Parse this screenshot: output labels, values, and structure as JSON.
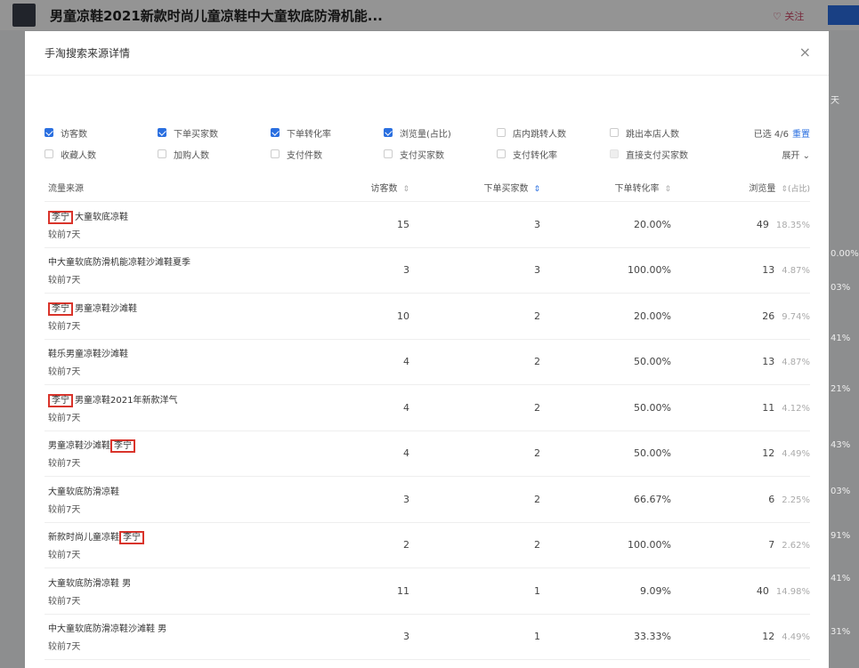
{
  "page": {
    "product_title": "男童凉鞋2021新款时尚儿童凉鞋中大童软底防滑机能...",
    "fav_label": "♡ 关注"
  },
  "modal": {
    "title": "手淘搜索来源详情",
    "close_label": "×",
    "selected_text": "已选 4/6",
    "reset_label": "重置",
    "expand_label": "展开 ⌄"
  },
  "filters": {
    "row1": [
      {
        "label": "访客数",
        "state": "checked"
      },
      {
        "label": "下单买家数",
        "state": "checked"
      },
      {
        "label": "下单转化率",
        "state": "checked"
      },
      {
        "label": "浏览量(占比)",
        "state": "checked"
      },
      {
        "label": "店内跳转人数",
        "state": "unchecked"
      },
      {
        "label": "跳出本店人数",
        "state": "unchecked"
      }
    ],
    "row2": [
      {
        "label": "收藏人数",
        "state": "unchecked"
      },
      {
        "label": "加购人数",
        "state": "unchecked"
      },
      {
        "label": "支付件数",
        "state": "unchecked"
      },
      {
        "label": "支付买家数",
        "state": "unchecked"
      },
      {
        "label": "支付转化率",
        "state": "unchecked"
      },
      {
        "label": "直接支付买家数",
        "state": "disabled"
      }
    ]
  },
  "table": {
    "headers": {
      "source": "流量来源",
      "visitors": "访客数",
      "buyers": "下单买家数",
      "conversion": "下单转化率",
      "pageviews": "浏览量",
      "share": "(占比)"
    },
    "rows": [
      {
        "keyword_hl": "李宁",
        "name": "大童软底凉鞋",
        "period": "较前7天",
        "visitors": "15",
        "buyers": "3",
        "conversion": "20.00%",
        "pageviews": "49",
        "share": "18.35%"
      },
      {
        "keyword_hl": "",
        "name": "中大童软底防滑机能凉鞋沙滩鞋夏季",
        "period": "较前7天",
        "visitors": "3",
        "buyers": "3",
        "conversion": "100.00%",
        "pageviews": "13",
        "share": "4.87%"
      },
      {
        "keyword_hl": "李宁",
        "name": "男童凉鞋沙滩鞋",
        "period": "较前7天",
        "visitors": "10",
        "buyers": "2",
        "conversion": "20.00%",
        "pageviews": "26",
        "share": "9.74%"
      },
      {
        "keyword_hl": "",
        "name": "鞋乐男童凉鞋沙滩鞋",
        "period": "较前7天",
        "visitors": "4",
        "buyers": "2",
        "conversion": "50.00%",
        "pageviews": "13",
        "share": "4.87%"
      },
      {
        "keyword_hl": "李宁",
        "name": "男童凉鞋2021年新款洋气",
        "period": "较前7天",
        "visitors": "4",
        "buyers": "2",
        "conversion": "50.00%",
        "pageviews": "11",
        "share": "4.12%"
      },
      {
        "keyword_hl": "",
        "name": "男童凉鞋沙滩鞋",
        "keyword_after": "李宁",
        "period": "较前7天",
        "visitors": "4",
        "buyers": "2",
        "conversion": "50.00%",
        "pageviews": "12",
        "share": "4.49%"
      },
      {
        "keyword_hl": "",
        "name": "大童软底防滑凉鞋",
        "period": "较前7天",
        "visitors": "3",
        "buyers": "2",
        "conversion": "66.67%",
        "pageviews": "6",
        "share": "2.25%"
      },
      {
        "keyword_hl": "",
        "name": "新款时尚儿童凉鞋",
        "keyword_after": "李宁",
        "period": "较前7天",
        "visitors": "2",
        "buyers": "2",
        "conversion": "100.00%",
        "pageviews": "7",
        "share": "2.62%"
      },
      {
        "keyword_hl": "",
        "name": "大童软底防滑凉鞋 男",
        "period": "较前7天",
        "visitors": "11",
        "buyers": "1",
        "conversion": "9.09%",
        "pageviews": "40",
        "share": "14.98%"
      },
      {
        "keyword_hl": "",
        "name": "中大童软底防滑凉鞋沙滩鞋 男",
        "period": "较前7天",
        "visitors": "3",
        "buyers": "1",
        "conversion": "33.33%",
        "pageviews": "12",
        "share": "4.49%"
      }
    ]
  },
  "side": {
    "right_tab": "天",
    "right_values": [
      "0.00%",
      "03%",
      "41%",
      "21%",
      "43%",
      "03%",
      "91%",
      "41%",
      "31%"
    ]
  }
}
